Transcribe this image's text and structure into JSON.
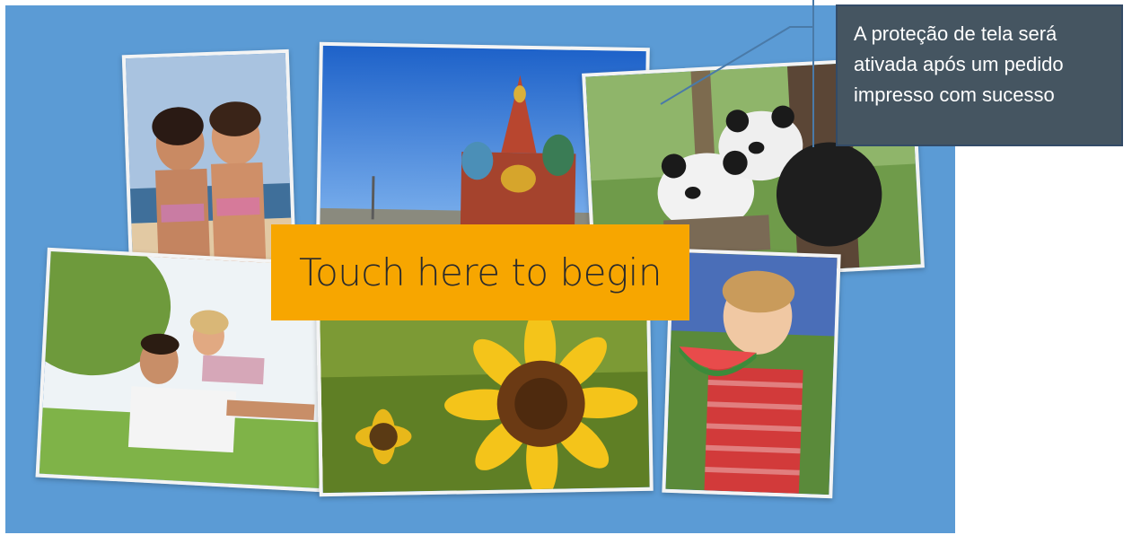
{
  "screen": {
    "background": "#5b9bd5",
    "cta_label": "Touch here to begin",
    "cta_color": "#f7a600"
  },
  "photos": [
    {
      "name": "beach-friends-photo"
    },
    {
      "name": "moscow-cathedral-photo"
    },
    {
      "name": "pandas-photo"
    },
    {
      "name": "father-daughter-photo"
    },
    {
      "name": "sunflower-photo"
    },
    {
      "name": "girl-watermelon-photo"
    }
  ],
  "callout": {
    "line1": "A proteção de tela será",
    "line2": "ativada após um pedido",
    "line3": "impresso com sucesso",
    "background": "#455561"
  }
}
